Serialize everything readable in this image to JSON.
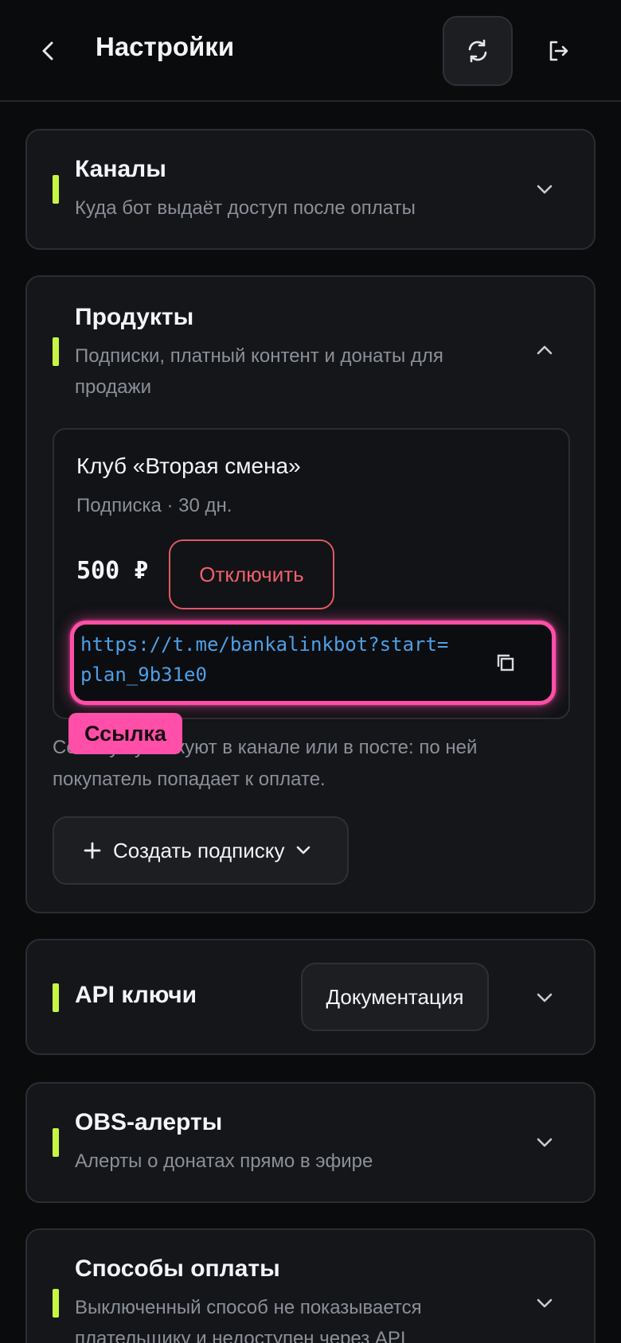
{
  "header": {
    "title": "Настройки",
    "back_icon": "chevron-left-icon",
    "refresh_icon": "refresh-icon",
    "logout_icon": "logout-icon"
  },
  "channels": {
    "title": "Каналы",
    "subtitle": "Куда бот выдаёт доступ после оплаты"
  },
  "products": {
    "title": "Продукты",
    "subtitle": "Подписки, платный контент и донаты для продажи",
    "item": {
      "name": "Клуб «Вторая смена»",
      "meta": "Подписка · 30 дн.",
      "price": "500 ₽",
      "disable_label": "Отключить",
      "link": "https://t.me/bankalinkbot?start=plan_9b31e0"
    },
    "tag_label": "Ссылка",
    "hint": "Ссылку публикуют в канале или в посте: по ней покупатель попадает к оплате.",
    "create_label": "Создать подписку"
  },
  "api": {
    "title": "API ключи",
    "docs_label": "Документация"
  },
  "obs": {
    "title": "OBS-алерты",
    "subtitle": "Алерты о донатах прямо в эфире"
  },
  "payments": {
    "title": "Способы оплаты",
    "subtitle": "Выключенный способ не показывается плательщику и недоступен через API"
  },
  "colors": {
    "accent": "#c8f542",
    "highlight": "#ff4fa8",
    "danger": "#f0606b",
    "link": "#4d9fe6"
  }
}
